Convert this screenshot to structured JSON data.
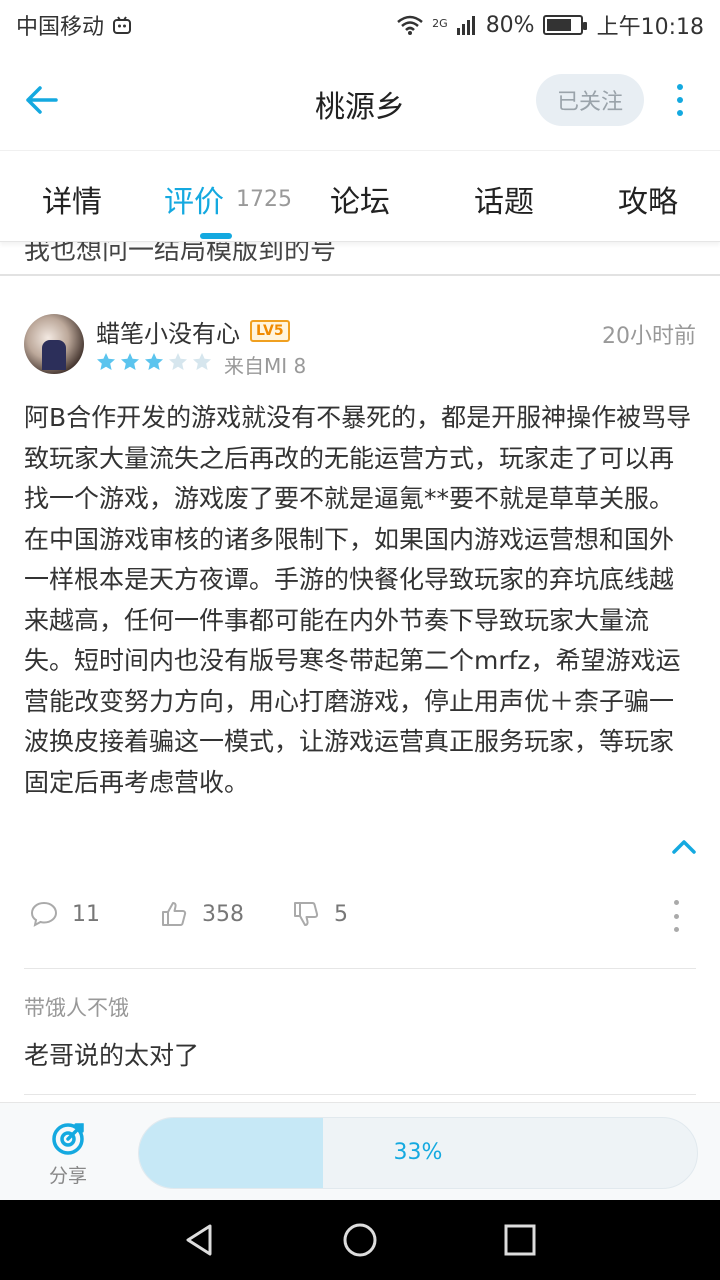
{
  "status_bar": {
    "carrier": "中国移动",
    "network": "2G",
    "battery": "80%",
    "battery_level": 0.8,
    "time": "上午10:18"
  },
  "header": {
    "title": "桃源乡",
    "follow_label": "已关注"
  },
  "tabs": [
    {
      "label": "详情"
    },
    {
      "label": "评价",
      "count": "1725",
      "active": true
    },
    {
      "label": "论坛"
    },
    {
      "label": "话题"
    },
    {
      "label": "攻略"
    }
  ],
  "previous_item": {
    "partial_text": "我也想问一结局模版到的号"
  },
  "review": {
    "username": "蜡笔小没有心",
    "level": "LV5",
    "time_ago": "20小时前",
    "rating": 3,
    "rating_max": 5,
    "device": "来自MI 8",
    "body": "阿B合作开发的游戏就没有不暴死的，都是开服神操作被骂导致玩家大量流失之后再改的无能运营方式，玩家走了可以再找一个游戏，游戏废了要不就是逼氪**要不就是草草关服。在中国游戏审核的诸多限制下，如果国内游戏运营想和国外一样根本是天方夜谭。手游的快餐化导致玩家的弃坑底线越来越高，任何一件事都可能在内外节奏下导致玩家大量流失。短时间内也没有版号寒冬带起第二个mrfz，希望游戏运营能改变努力方向，用心打磨游戏，停止用声优＋柰子骗一波换皮接着骗这一模式，让游戏运营真正服务玩家，等玩家固定后再考虑营收。",
    "comments": "11",
    "likes": "358",
    "dislikes": "5"
  },
  "reply": {
    "author": "带饿人不饿",
    "text": "老哥说的太对了"
  },
  "bottom_bar": {
    "share_label": "分享",
    "progress_label": "33%",
    "progress_value": 0.33
  },
  "colors": {
    "accent": "#14a9e0",
    "star_filled": "#5bc4ee",
    "star_empty": "#d6e6ee"
  }
}
